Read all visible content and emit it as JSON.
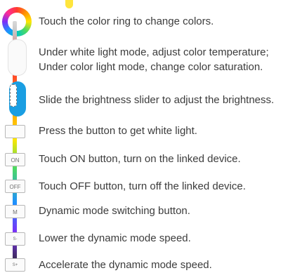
{
  "instructions": [
    {
      "text": "Touch the color ring to change colors."
    },
    {
      "text": "Under white light mode, adjust color temperature;",
      "text2": "Under color light mode, change color saturation."
    },
    {
      "text": "Slide the brightness slider to adjust the brightness."
    },
    {
      "text": "Press the button to get white light.",
      "button": ""
    },
    {
      "text": "Touch ON button, turn on the linked device.",
      "button": "ON"
    },
    {
      "text": "Touch OFF button, turn off the linked device.",
      "button": "OFF"
    },
    {
      "text": "Dynamic mode switching button.",
      "button": "M"
    },
    {
      "text": "Lower the dynamic mode speed.",
      "button": "S-"
    },
    {
      "text": "Accelerate the dynamic mode speed.",
      "button": "S+"
    }
  ],
  "colors": {
    "brightness_slider": "#1a9ee2",
    "accent_yellow": "#ffe53d"
  }
}
